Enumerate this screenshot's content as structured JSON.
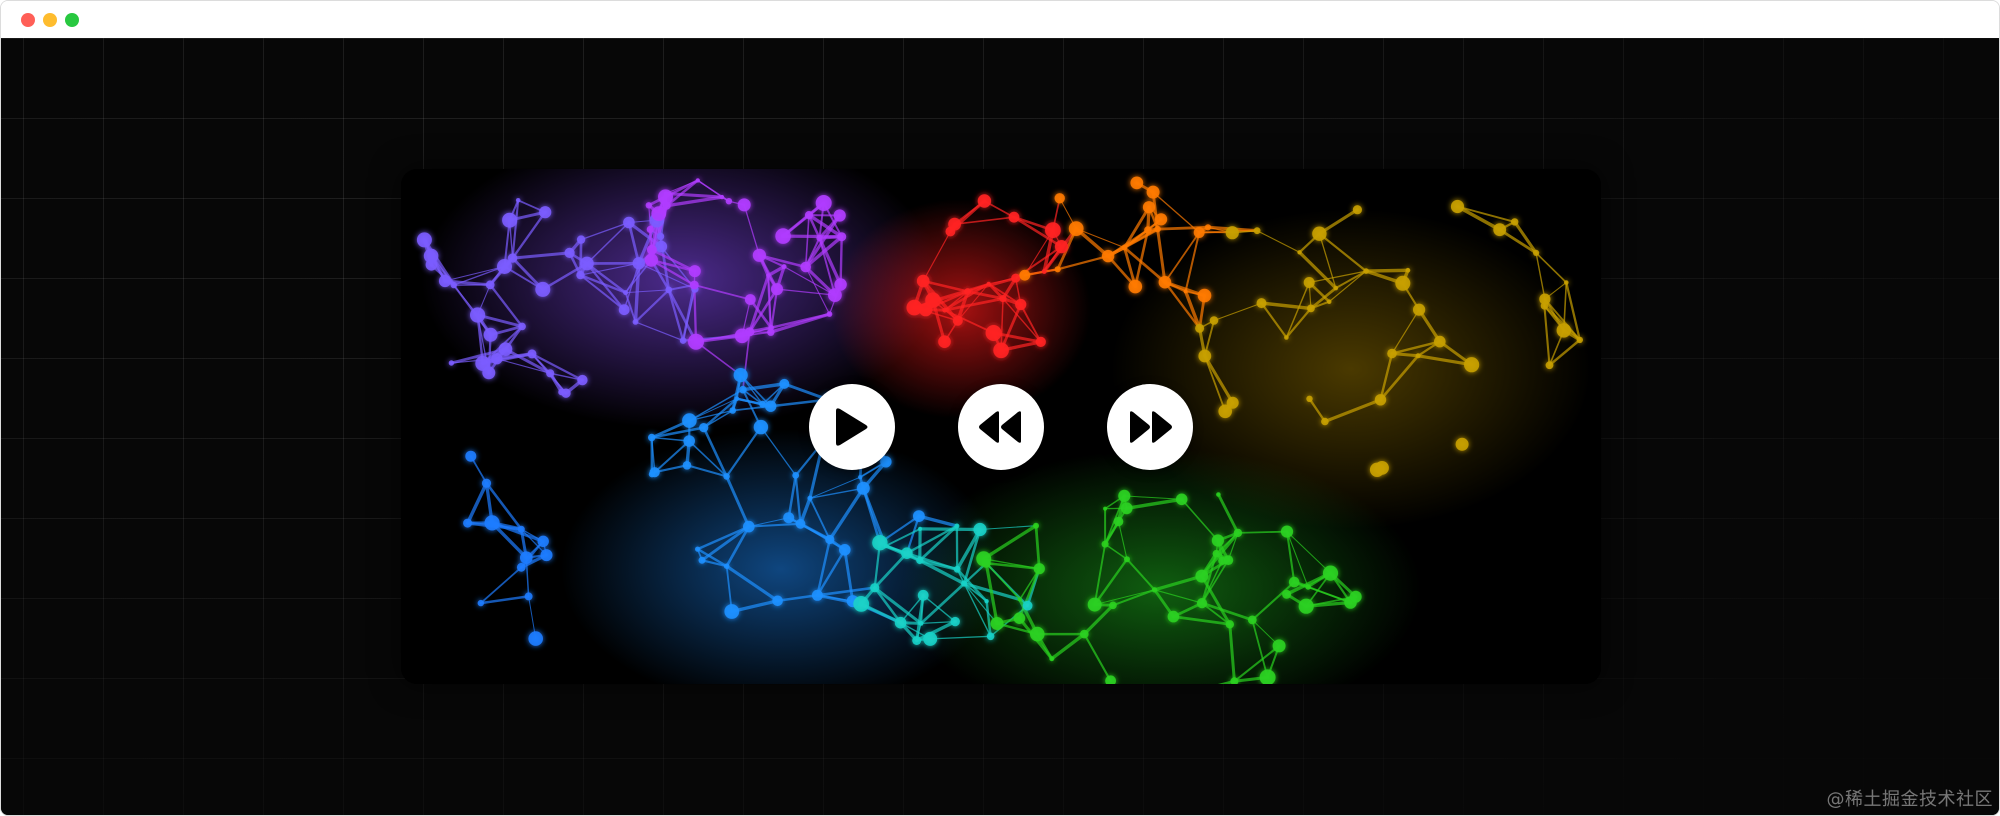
{
  "window": {
    "traffic_lights": {
      "close_color": "#ff5f57",
      "minimize_color": "#febc2e",
      "maximize_color": "#28c840"
    }
  },
  "page": {
    "background_color": "#070707",
    "grid": "on"
  },
  "player": {
    "artwork": "colorful-particle-network",
    "palette": [
      "#7b5cff",
      "#b03cff",
      "#ff2020",
      "#ff7a00",
      "#c8a000",
      "#2ad020",
      "#19d1c8",
      "#1e90ff"
    ],
    "controls": [
      {
        "name": "play-button",
        "icon": "play-icon"
      },
      {
        "name": "rewind-button",
        "icon": "rewind-icon"
      },
      {
        "name": "fast-forward-button",
        "icon": "fast-forward-icon"
      }
    ]
  },
  "watermark": {
    "text": "@稀土掘金技术社区"
  }
}
